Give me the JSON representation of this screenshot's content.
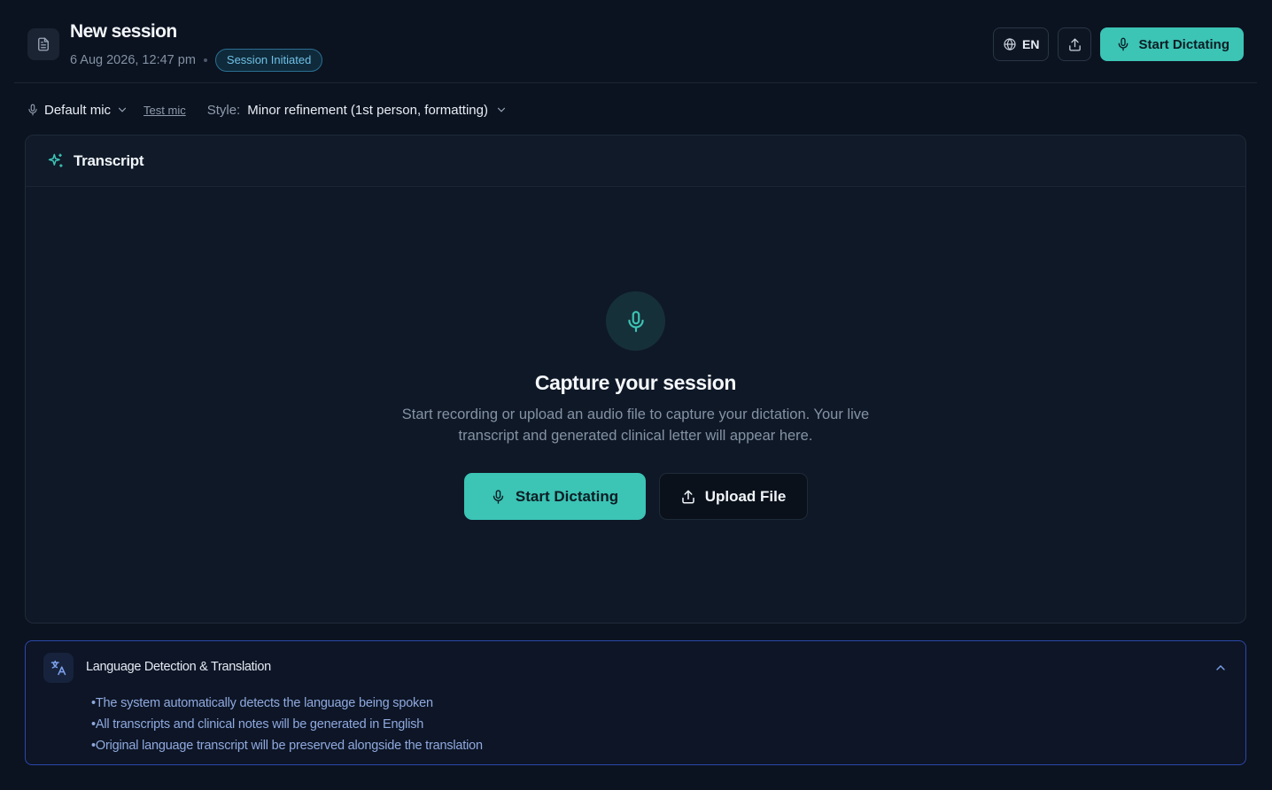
{
  "header": {
    "title": "New session",
    "date": "6 Aug 2026, 12:47 pm",
    "status_badge": "Session Initiated",
    "language": "EN",
    "start_dictating_label": "Start Dictating"
  },
  "toolbar": {
    "mic_label": "Default mic",
    "test_mic_label": "Test mic",
    "style_label": "Style:",
    "style_value": "Minor refinement (1st person, formatting)"
  },
  "transcript": {
    "panel_title": "Transcript",
    "empty_title": "Capture your session",
    "empty_description": "Start recording or upload an audio file to capture your dictation. Your live transcript and generated clinical letter will appear here.",
    "start_button": "Start Dictating",
    "upload_button": "Upload File"
  },
  "language_panel": {
    "title": "Language Detection & Translation",
    "items": [
      "The system automatically detects the language being spoken",
      "All transcripts and clinical notes will be generated in English",
      "Original language transcript will be preserved alongside the translation"
    ]
  },
  "colors": {
    "accent": "#3cc4b5",
    "background": "#0b1320",
    "badge": "#6fc0e6",
    "info_border": "#2b47a8"
  },
  "icons": [
    "document-icon",
    "globe-icon",
    "share-icon",
    "mic-icon",
    "chevron-down-icon",
    "sparkle-icon",
    "upload-icon",
    "translate-icon",
    "chevron-up-icon"
  ]
}
